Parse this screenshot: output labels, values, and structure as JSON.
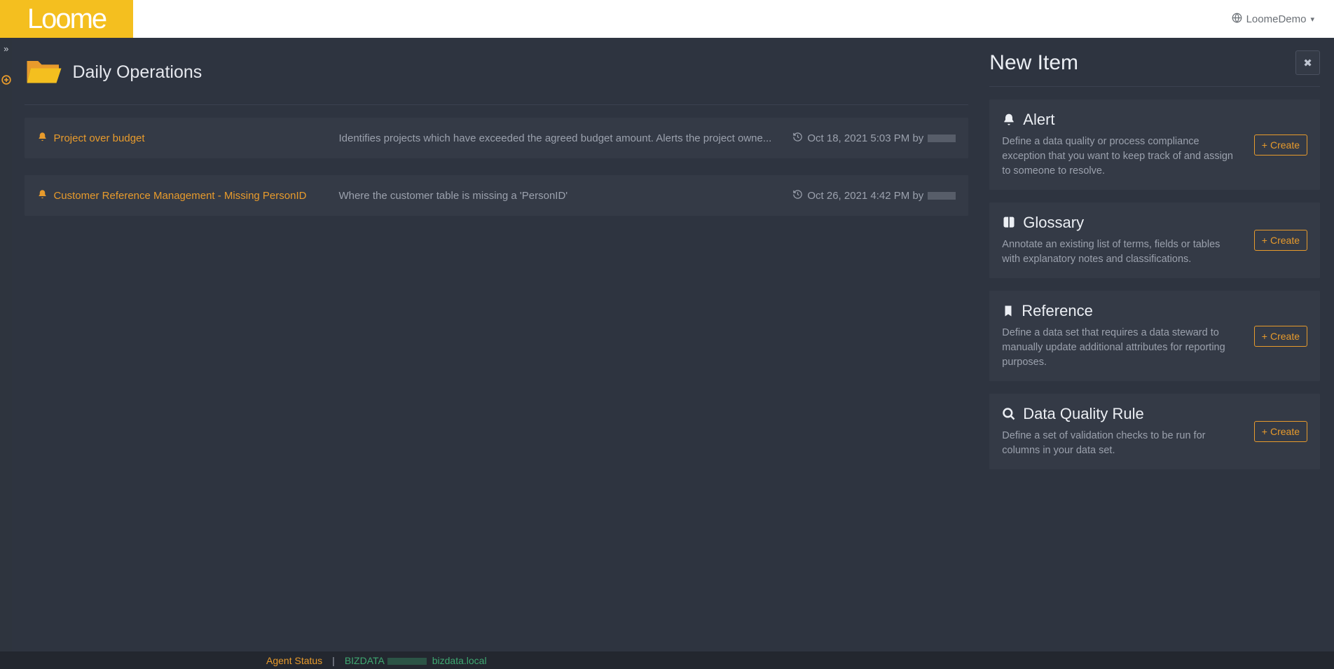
{
  "header": {
    "logo_text": "Loome",
    "user_label": "LoomeDemo"
  },
  "page": {
    "title": "Daily Operations"
  },
  "items": [
    {
      "title": "Project over budget",
      "description": "Identifies projects which have exceeded the agreed budget amount. Alerts the project owne...",
      "timestamp": "Oct 18, 2021 5:03 PM by",
      "author_redacted": true
    },
    {
      "title": "Customer Reference Management - Missing PersonID",
      "description": "Where the customer table is missing a 'PersonID'",
      "timestamp": "Oct 26, 2021 4:42 PM by",
      "author_redacted": true
    }
  ],
  "panel": {
    "heading": "New Item",
    "cards": [
      {
        "icon": "bell",
        "title": "Alert",
        "desc": "Define a data quality or process compliance exception that you want to keep track of and assign to someone to resolve.",
        "button": "Create"
      },
      {
        "icon": "book",
        "title": "Glossary",
        "desc": "Annotate an existing list of terms, fields or tables with explanatory notes and classifications.",
        "button": "Create"
      },
      {
        "icon": "bookmark",
        "title": "Reference",
        "desc": "Define a data set that requires a data steward to manually update additional attributes for reporting purposes.",
        "button": "Create"
      },
      {
        "icon": "search",
        "title": "Data Quality Rule",
        "desc": "Define a set of validation checks to be run for columns in your data set.",
        "button": "Create"
      }
    ]
  },
  "footer": {
    "agent_label": "Agent Status",
    "host_prefix": "BIZDATA",
    "host_suffix": "bizdata.local"
  }
}
